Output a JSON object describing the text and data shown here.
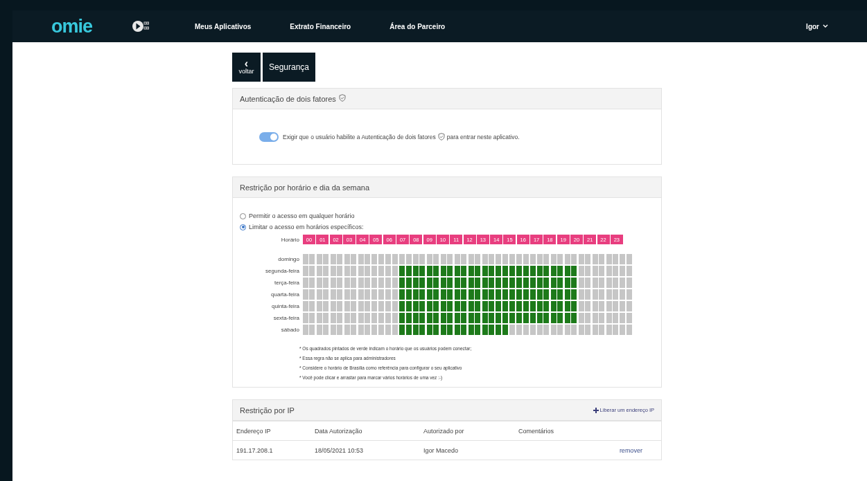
{
  "nav": {
    "logo": "omie",
    "links": [
      {
        "label": "Meus Aplicativos"
      },
      {
        "label": "Extrato Financeiro"
      },
      {
        "label": "Área do Parceiro"
      }
    ],
    "user": "Igor"
  },
  "header": {
    "back": {
      "arrow": "‹",
      "label": "voltar"
    },
    "title": "Segurança"
  },
  "two_factor": {
    "title": "Autenticação de dois fatores",
    "toggle": {
      "on": true,
      "label_before": "Exigir que o usuário habilite a Autenticação de dois fatores",
      "label_after": "para entrar neste aplicativo."
    }
  },
  "schedule": {
    "title": "Restrição por horário e dia da semana",
    "options": [
      {
        "label": "Permitir o acesso em qualquer horário",
        "selected": false
      },
      {
        "label": "Limitar o acesso em horários específicos:",
        "selected": true
      }
    ],
    "hours_label": "Horário",
    "hours": [
      "00",
      "01",
      "02",
      "03",
      "04",
      "05",
      "06",
      "07",
      "08",
      "09",
      "10",
      "11",
      "12",
      "13",
      "14",
      "15",
      "16",
      "17",
      "18",
      "19",
      "20",
      "21",
      "22",
      "23"
    ],
    "days": [
      {
        "name": "domingo",
        "slots": [
          false,
          false,
          false,
          false,
          false,
          false,
          false,
          false,
          false,
          false,
          false,
          false,
          false,
          false,
          false,
          false,
          false,
          false,
          false,
          false,
          false,
          false,
          false,
          false,
          false,
          false,
          false,
          false,
          false,
          false,
          false,
          false,
          false,
          false,
          false,
          false,
          false,
          false,
          false,
          false,
          false,
          false,
          false,
          false,
          false,
          false,
          false,
          false
        ]
      },
      {
        "name": "segunda-feira",
        "slots": [
          false,
          false,
          false,
          false,
          false,
          false,
          false,
          false,
          false,
          false,
          false,
          false,
          false,
          false,
          true,
          true,
          true,
          true,
          true,
          true,
          true,
          true,
          true,
          true,
          true,
          true,
          true,
          true,
          true,
          true,
          true,
          true,
          true,
          true,
          true,
          true,
          true,
          true,
          true,
          true,
          false,
          false,
          false,
          false,
          false,
          false,
          false,
          false
        ]
      },
      {
        "name": "terça-feira",
        "slots": [
          false,
          false,
          false,
          false,
          false,
          false,
          false,
          false,
          false,
          false,
          false,
          false,
          false,
          false,
          true,
          true,
          true,
          true,
          true,
          true,
          true,
          true,
          true,
          true,
          true,
          true,
          true,
          true,
          true,
          true,
          true,
          true,
          true,
          true,
          true,
          true,
          true,
          true,
          true,
          true,
          false,
          false,
          false,
          false,
          false,
          false,
          false,
          false
        ]
      },
      {
        "name": "quarta-feira",
        "slots": [
          false,
          false,
          false,
          false,
          false,
          false,
          false,
          false,
          false,
          false,
          false,
          false,
          false,
          false,
          true,
          true,
          true,
          true,
          true,
          true,
          true,
          true,
          true,
          true,
          true,
          true,
          true,
          true,
          true,
          true,
          true,
          true,
          true,
          true,
          true,
          true,
          true,
          true,
          true,
          true,
          false,
          false,
          false,
          false,
          false,
          false,
          false,
          false
        ]
      },
      {
        "name": "quinta-feira",
        "slots": [
          false,
          false,
          false,
          false,
          false,
          false,
          false,
          false,
          false,
          false,
          false,
          false,
          false,
          false,
          true,
          true,
          true,
          true,
          true,
          true,
          true,
          true,
          true,
          true,
          true,
          true,
          true,
          true,
          true,
          true,
          true,
          true,
          true,
          true,
          true,
          true,
          true,
          true,
          true,
          true,
          false,
          false,
          false,
          false,
          false,
          false,
          false,
          false
        ]
      },
      {
        "name": "sexta-feira",
        "slots": [
          false,
          false,
          false,
          false,
          false,
          false,
          false,
          false,
          false,
          false,
          false,
          false,
          false,
          false,
          true,
          true,
          true,
          true,
          true,
          true,
          true,
          true,
          true,
          true,
          true,
          true,
          true,
          true,
          true,
          true,
          true,
          true,
          true,
          true,
          true,
          true,
          true,
          true,
          true,
          true,
          false,
          false,
          false,
          false,
          false,
          false,
          false,
          false
        ]
      },
      {
        "name": "sábado",
        "slots": [
          false,
          false,
          false,
          false,
          false,
          false,
          false,
          false,
          false,
          false,
          false,
          false,
          false,
          false,
          true,
          true,
          true,
          true,
          true,
          true,
          true,
          true,
          true,
          true,
          true,
          true,
          true,
          true,
          true,
          true,
          false,
          false,
          false,
          false,
          false,
          false,
          false,
          false,
          false,
          false,
          false,
          false,
          false,
          false,
          false,
          false,
          false,
          false
        ]
      }
    ],
    "notes": [
      "* Os quadrados pintados de verde indicam o horário que os usuários podem conectar;",
      "* Essa regra não se aplica para administradores",
      "* Considere o horário de Brasília como referência para configurar o seu aplicativo",
      "* Você pode clicar e arrastar para marcar vários horários de uma vez :-)"
    ]
  },
  "ip": {
    "title": "Restrição por IP",
    "add_link": "Liberar um endereço IP",
    "columns": [
      "Endereço IP",
      "Data Autorização",
      "Autorizado por",
      "Comentários"
    ],
    "rows": [
      {
        "cells": [
          "191.17.208.1",
          "18/05/2021 10:53",
          "Igor Macedo",
          ""
        ],
        "action": "remover"
      }
    ]
  }
}
